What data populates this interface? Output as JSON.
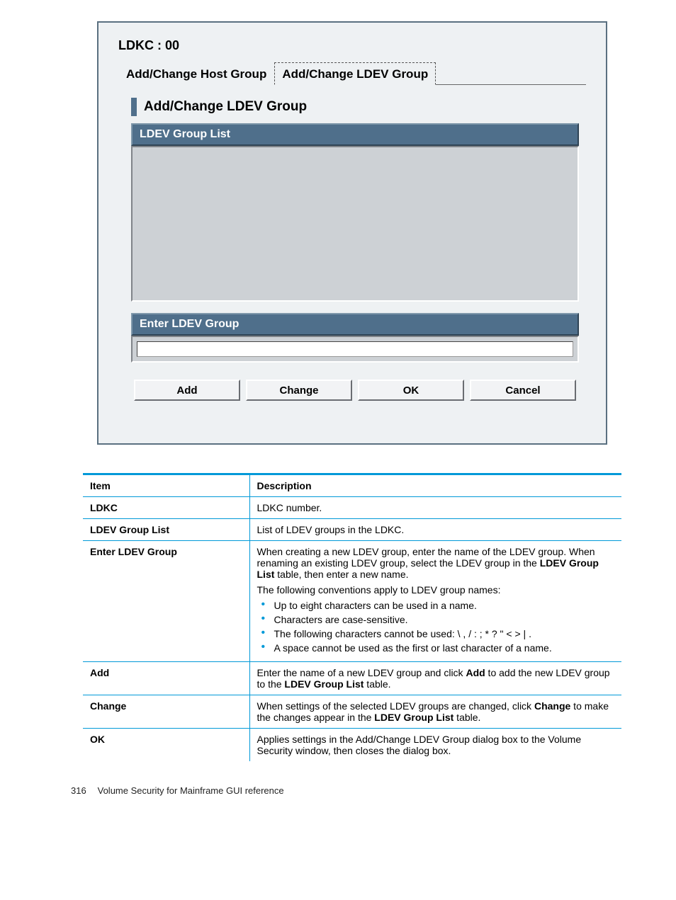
{
  "dialog": {
    "title": "LDKC : 00",
    "tabs": {
      "host": "Add/Change Host Group",
      "ldev": "Add/Change LDEV Group"
    },
    "panel_heading": "Add/Change LDEV Group",
    "list_header": "LDEV Group List",
    "enter_header": "Enter LDEV Group",
    "input_value": "",
    "buttons": {
      "add": "Add",
      "change": "Change",
      "ok": "OK",
      "cancel": "Cancel"
    }
  },
  "table": {
    "head": {
      "item": "Item",
      "desc": "Description"
    },
    "rows": {
      "ldkc": {
        "item": "LDKC",
        "desc": "LDKC number."
      },
      "list": {
        "item": "LDEV Group List",
        "desc": "List of LDEV groups in the LDKC."
      },
      "enter": {
        "item": "Enter LDEV Group",
        "p1a": "When creating a new LDEV group, enter the name of the LDEV group. When renaming an existing LDEV group, select the LDEV group in the ",
        "p1b": "LDEV Group List",
        "p1c": " table, then enter a new name.",
        "p2": "The following conventions apply to LDEV group names:",
        "b1": "Up to eight characters can be used in a name.",
        "b2": "Characters are case-sensitive.",
        "b3": "The following characters cannot be used: \\ , / : ; * ? \" < > | .",
        "b4": "A space cannot be used as the first or last character of a name."
      },
      "add": {
        "item": "Add",
        "a": "Enter the name of a new LDEV group and click ",
        "b": "Add",
        "c": " to add the new LDEV group to the ",
        "d": "LDEV Group List",
        "e": " table."
      },
      "change": {
        "item": "Change",
        "a": "When settings of the selected LDEV groups are changed, click ",
        "b": "Change",
        "c": " to make the changes appear in the ",
        "d": "LDEV Group List",
        "e": " table."
      },
      "ok": {
        "item": "OK",
        "desc": "Applies settings in the Add/Change LDEV Group dialog box to the Volume Security window, then closes the dialog box."
      }
    }
  },
  "footer": {
    "page": "316",
    "title": "Volume Security for Mainframe GUI reference"
  }
}
